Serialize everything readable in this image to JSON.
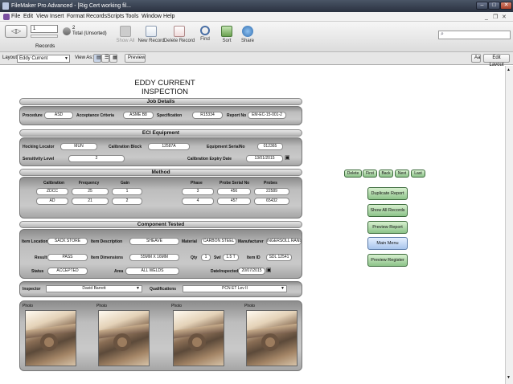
{
  "window": {
    "title": "FileMaker Pro Advanced - [Rig Cert working fil..."
  },
  "menu": [
    "File",
    "Edit",
    "View",
    "Insert",
    "Format",
    "Records",
    "Scripts",
    "Tools",
    "Window",
    "Help"
  ],
  "toolbar": {
    "record_value": "1",
    "total_count": "2",
    "total_label": "Total (Unsorted)",
    "records_label": "Records",
    "show_all": "Show All",
    "new_record": "New Record",
    "delete_record": "Delete Record",
    "find": "Find",
    "sort": "Sort",
    "share": "Share"
  },
  "layoutbar": {
    "layout_label": "Layout:",
    "layout_value": "Eddy Current",
    "view_as_label": "View As:",
    "preview": "Preview",
    "aa": "Aa",
    "edit_layout": "Edit Layout"
  },
  "form": {
    "title": "EDDY CURRENT INSPECTION",
    "job_details": {
      "header": "Job Details",
      "procedure_label": "Procedure",
      "procedure": "ASD",
      "acceptance_label": "Acceptance Criteria",
      "acceptance": "ASME B8",
      "specification_label": "Specification",
      "specification": "R15334",
      "report_label": "Report No",
      "report": "EM-EC-15-001-2"
    },
    "eci": {
      "header": "ECI Equipment",
      "hocking_label": "Hocking Locator",
      "hocking": "MUN",
      "calblock_label": "Calibration Block",
      "calblock": "12587A",
      "serial_label": "Equipment SerialNo",
      "serial": "012365",
      "sensitivity_label": "Sensitivity Level",
      "sensitivity": "2",
      "expiry_label": "Calibration Expiry Date",
      "expiry": "13/01/2015"
    },
    "method": {
      "header": "Method",
      "col_calibration": "Calibration",
      "col_frequency": "Frequency",
      "col_gain": "Gain",
      "col_phase": "Phase",
      "col_probe_serial": "Probe Serial No",
      "col_probes": "Probes",
      "rows": [
        {
          "calibration": "ZDCC",
          "frequency": "25",
          "gain": "1",
          "phase": "3",
          "probe_serial": "456",
          "probes": "22589"
        },
        {
          "calibration": "AD",
          "frequency": "21",
          "gain": "2",
          "phase": "4",
          "probe_serial": "457",
          "probes": "65432"
        }
      ]
    },
    "component": {
      "header": "Component Tested",
      "location_label": "Item Location",
      "location": "SACK STORE",
      "description_label": "Item Description",
      "description": "SHEAVE",
      "material_label": "Material",
      "material": "CARBON STEEL",
      "manufacturer_label": "Manufacturer",
      "manufacturer": "INGERSOLL RAND",
      "result_label": "Result",
      "result": "PASS",
      "dimensions_label": "Item Dimensions",
      "dimensions": "55MM X 16MM",
      "qty_label": "Qty",
      "qty": "1",
      "swl_label": "Swl",
      "swl": "1.5 T",
      "itemid_label": "Item ID",
      "itemid": "SDL 12541",
      "status_label": "Status",
      "status": "ACCEPTED",
      "area_label": "Area",
      "area": "ALL WELDS",
      "date_label": "DateInspected",
      "date": "20/07/2015"
    },
    "inspector_label": "Inspector",
    "inspector": "David Barrett",
    "qualifications_label": "Qualifications",
    "qualifications": "PCN ET Lev II",
    "photos": [
      "Photo",
      "Photo",
      "Photo",
      "Photo"
    ]
  },
  "nav_buttons": [
    "Delete",
    "First",
    "Back",
    "Next",
    "Last"
  ],
  "side_buttons": [
    "Duplicate Report",
    "Show All Records",
    "Preview Report",
    "Main Menu",
    "Preview Register"
  ]
}
